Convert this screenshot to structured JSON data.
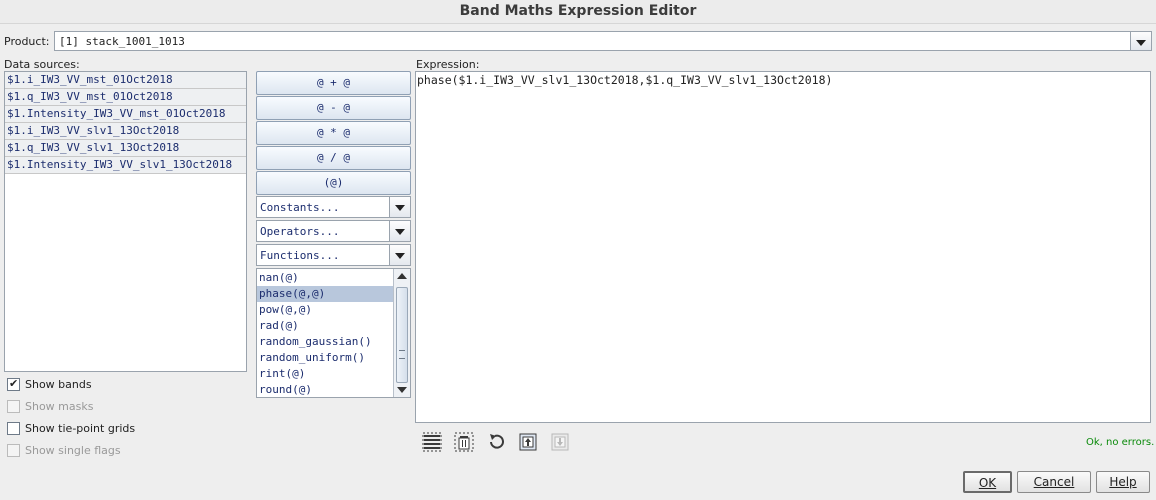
{
  "window": {
    "title": "Band Maths Expression Editor"
  },
  "product": {
    "label": "Product:",
    "value": "[1] stack_1001_1013"
  },
  "data_sources": {
    "label": "Data sources:",
    "items": [
      "$1.i_IW3_VV_mst_01Oct2018",
      "$1.q_IW3_VV_mst_01Oct2018",
      "$1.Intensity_IW3_VV_mst_01Oct2018",
      "$1.i_IW3_VV_slv1_13Oct2018",
      "$1.q_IW3_VV_slv1_13Oct2018",
      "$1.Intensity_IW3_VV_slv1_13Oct2018"
    ]
  },
  "op_buttons": {
    "add": "@ + @",
    "sub": "@ - @",
    "mul": "@ * @",
    "div": "@ / @",
    "paren": "(@)"
  },
  "dropdowns": {
    "constants": "Constants...",
    "operators": "Operators...",
    "functions": "Functions..."
  },
  "functions_list": {
    "items": [
      "nan(@)",
      "phase(@,@)",
      "pow(@,@)",
      "rad(@)",
      "random_gaussian()",
      "random_uniform()",
      "rint(@)",
      "round(@)"
    ],
    "selected_index": 1
  },
  "expression": {
    "label": "Expression:",
    "value": "phase($1.i_IW3_VV_slv1_13Oct2018,$1.q_IW3_VV_slv1_13Oct2018)"
  },
  "options": {
    "show_bands": {
      "label": "Show bands",
      "checked": true
    },
    "show_masks": {
      "label": "Show masks",
      "checked": false
    },
    "show_tie_point_grids": {
      "label": "Show tie-point grids",
      "checked": false
    },
    "show_single_flags": {
      "label": "Show single flags",
      "checked": false
    }
  },
  "status": {
    "text": "Ok, no errors.",
    "color": "#0a8a0a"
  },
  "dialog_buttons": {
    "ok": "OK",
    "cancel": "Cancel",
    "help": "Help"
  },
  "toolbar_icons": [
    "select-all-icon",
    "delete-icon",
    "undo-icon",
    "import-icon",
    "export-icon"
  ]
}
